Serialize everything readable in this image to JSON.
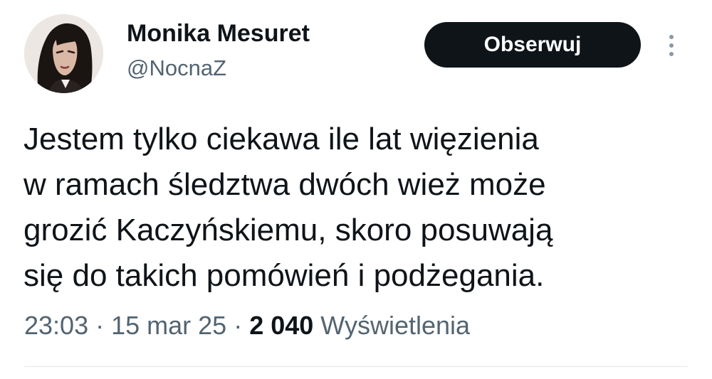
{
  "author": {
    "name": "Monika Mesuret",
    "handle": "@NocnaZ"
  },
  "follow_button_label": "Obserwuj",
  "tweet": {
    "lines": [
      "Jestem tylko ciekawa ile lat więzienia",
      "w ramach śledztwa dwóch wież może",
      "grozić Kaczyńskiemu, skoro posuwają",
      "się do takich pomówień i podżegania."
    ]
  },
  "meta": {
    "time": "23:03",
    "separator": " · ",
    "date": "15 mar 25",
    "views_count": "2 040",
    "views_label": "Wyświetlenia"
  },
  "colors": {
    "text": "#0f1419",
    "secondary": "#536471",
    "button_bg": "#0f1419",
    "button_text": "#ffffff",
    "divider": "#e3e7ea"
  },
  "icons": {
    "more": "more-vertical-icon"
  }
}
